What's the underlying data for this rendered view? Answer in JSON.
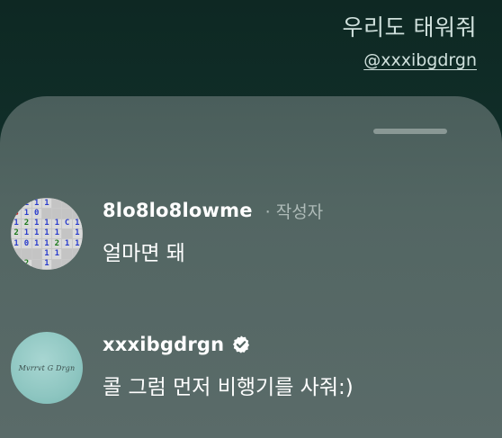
{
  "story": {
    "title": "우리도 태워줘",
    "mention": "@xxxibgdrgn"
  },
  "comments": [
    {
      "username": "8lo8lo8lowme",
      "author_tag": "· 작성자",
      "text": "얼마면 돼",
      "avatar": "minesweeper-avatar"
    },
    {
      "username": "xxxibgdrgn",
      "verified": true,
      "text": "콜 그럼 먼저 비행기를 사줘:)",
      "avatar": "teal-signature-avatar",
      "avatar_text": "Mvrrvt G Drgn"
    }
  ],
  "minesweeper_cells": [
    [
      "",
      "1",
      "1",
      "1",
      "",
      "",
      ""
    ],
    [
      "3",
      "1",
      "0",
      "",
      "",
      "",
      ""
    ],
    [
      "1",
      "2",
      "1",
      "1",
      "1",
      "C",
      "1"
    ],
    [
      "2",
      "1",
      "1",
      "1",
      "1",
      "",
      "1"
    ],
    [
      "1",
      "0",
      "1",
      "1",
      "2",
      "1",
      "1"
    ],
    [
      "",
      "",
      "",
      "1",
      "1",
      "",
      ""
    ],
    [
      "",
      "2",
      "",
      "1",
      "",
      "",
      ""
    ]
  ],
  "colors": {
    "sheet": "#536663",
    "story_bg": "#12332d",
    "verified": "#ffffff",
    "author_tag": "#aebbb8"
  }
}
